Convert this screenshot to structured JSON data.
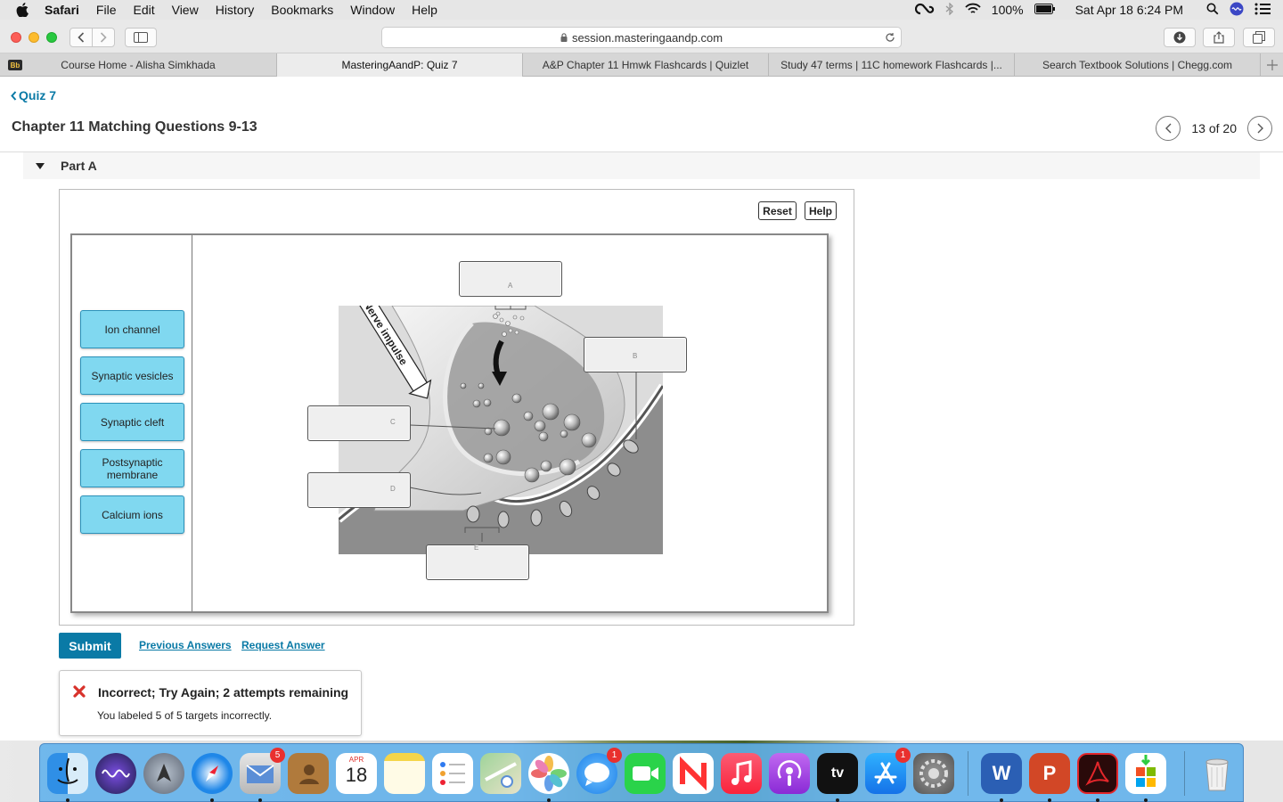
{
  "menubar": {
    "app": "Safari",
    "items": [
      "File",
      "Edit",
      "View",
      "History",
      "Bookmarks",
      "Window",
      "Help"
    ],
    "battery": "100%",
    "datetime": "Sat Apr 18  6:24 PM"
  },
  "browser": {
    "url": "session.masteringaandp.com",
    "tabs": [
      {
        "label": "Course Home - Alisha Simkhada"
      },
      {
        "label": "MasteringAandP: Quiz 7"
      },
      {
        "label": "A&P Chapter 11 Hmwk Flashcards | Quizlet"
      },
      {
        "label": "Study 47 terms | 11C homework Flashcards |..."
      },
      {
        "label": "Search Textbook Solutions | Chegg.com"
      }
    ],
    "tab_favicon": "Bb"
  },
  "page": {
    "breadcrumb": "Quiz 7",
    "title": "Chapter 11 Matching Questions 9-13",
    "pager": "13 of 20",
    "part": "Part A",
    "reset": "Reset",
    "help": "Help",
    "labels": [
      "Ion channel",
      "Synaptic vesicles",
      "Synaptic cleft",
      "Postsynaptic membrane",
      "Calcium ions"
    ],
    "targets": [
      "A",
      "B",
      "C",
      "D",
      "E"
    ],
    "diagram_text": "Nerve impulse",
    "submit": "Submit",
    "previous_answers": "Previous Answers",
    "request_answer": "Request Answer",
    "feedback": {
      "title": "Incorrect; Try Again; 2 attempts remaining",
      "detail": "You labeled 5 of 5 targets incorrectly."
    }
  },
  "dock": {
    "calendar_month": "APR",
    "calendar_day": "18",
    "appletv_label": "tv",
    "badges": {
      "mail": "5",
      "messages": "1",
      "appstore": "1"
    },
    "word_letter": "W",
    "ppt_letter": "P"
  }
}
